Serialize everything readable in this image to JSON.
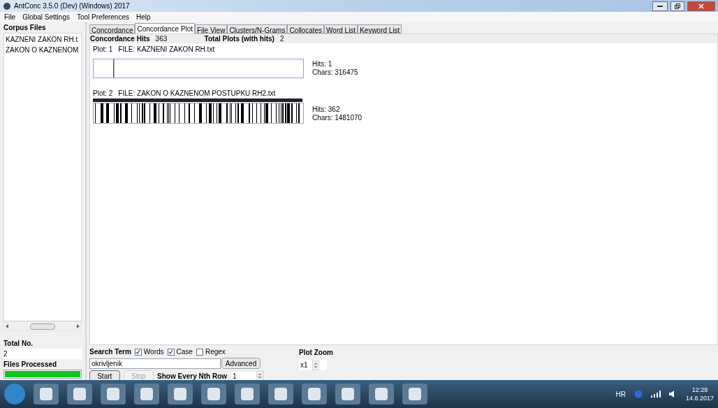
{
  "window": {
    "title": "AntConc 3.5.0 (Dev) (Windows) 2017"
  },
  "menu": [
    "File",
    "Global Settings",
    "Tool Preferences",
    "Help"
  ],
  "sidebar": {
    "heading": "Corpus Files",
    "files": [
      {
        "name": "KAZNENI ZAKON RH.t",
        "selected": false
      },
      {
        "name": "ZAKON O KAZNENOM",
        "selected": false
      }
    ],
    "total_label": "Total No.",
    "total_value": "2",
    "processed_label": "Files Processed",
    "progress": {
      "level": 1
    }
  },
  "tabs": [
    {
      "label": "Concordance",
      "selected": false
    },
    {
      "label": "Concordance Plot",
      "selected": true
    },
    {
      "label": "File View",
      "selected": false
    },
    {
      "label": "Clusters/N-Grams",
      "selected": false
    },
    {
      "label": "Collocates",
      "selected": false
    },
    {
      "label": "Word List",
      "selected": false
    },
    {
      "label": "Keyword List",
      "selected": false
    }
  ],
  "summary": {
    "hits_label": "Concordance Hits",
    "hits_value": "363",
    "plots_label": "Total Plots (with hits)",
    "plots_value": "2"
  },
  "plots": [
    {
      "label": "Plot: 1",
      "file": "FILE: KAZNENI ZAKON RH.txt",
      "hits": "Hits: 1",
      "chars": "Chars: 316475",
      "dense": false
    },
    {
      "label": "Plot: 2",
      "file": "FILE: ZAKON O KAZNENOM POSTUPKU RH2.txt",
      "hits": "Hits: 362",
      "chars": "Chars: 1481070",
      "dense": true
    }
  ],
  "search": {
    "label": "Search Term",
    "options": [
      {
        "label": "Words",
        "checked": true
      },
      {
        "label": "Case",
        "checked": true
      },
      {
        "label": "Regex",
        "checked": false
      }
    ],
    "value": "okrivljenik",
    "advanced": "Advanced",
    "start": "Start",
    "stop": {
      "label": "Stop",
      "disabled": true
    },
    "nth_label": "Show Every Nth Row",
    "nth_value": "1"
  },
  "zoom": {
    "label": "Plot Zoom",
    "value": "x1"
  },
  "taskbar": {
    "language": "HR",
    "time": "12:28",
    "date": "14.8.2017"
  }
}
